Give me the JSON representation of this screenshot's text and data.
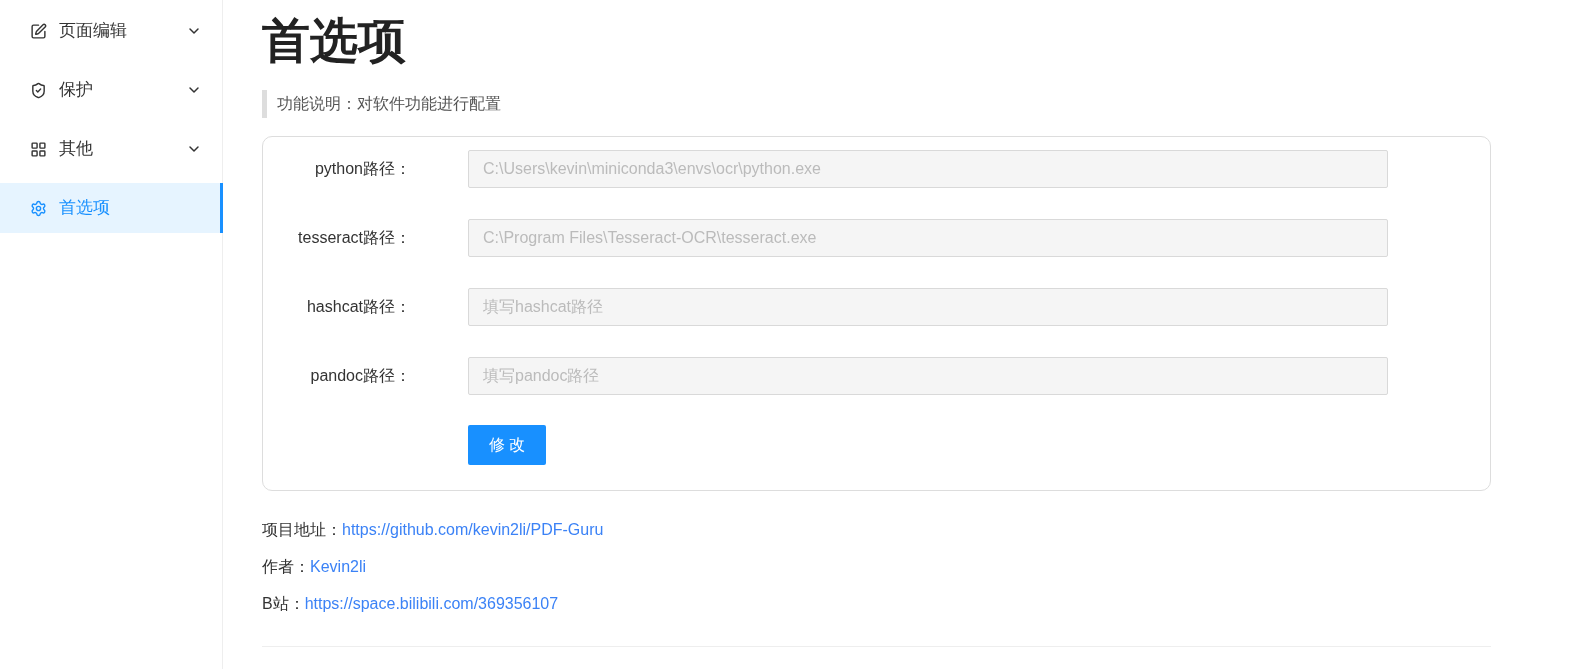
{
  "sidebar": {
    "items": [
      {
        "label": "页面编辑",
        "expandable": true,
        "selected": false
      },
      {
        "label": "保护",
        "expandable": true,
        "selected": false
      },
      {
        "label": "其他",
        "expandable": true,
        "selected": false
      },
      {
        "label": "首选项",
        "expandable": false,
        "selected": true
      }
    ]
  },
  "page": {
    "title": "首选项",
    "description": "功能说明：对软件功能进行配置"
  },
  "form": {
    "fields": [
      {
        "label": "python路径：",
        "value": "C:\\Users\\kevin\\miniconda3\\envs\\ocr\\python.exe",
        "disabled": true
      },
      {
        "label": "tesseract路径：",
        "value": "C:\\Program Files\\Tesseract-OCR\\tesseract.exe",
        "disabled": true
      },
      {
        "label": "hashcat路径：",
        "placeholder": "填写hashcat路径",
        "disabled": true
      },
      {
        "label": "pandoc路径：",
        "placeholder": "填写pandoc路径",
        "disabled": true
      }
    ],
    "submit": "修 改"
  },
  "info": [
    {
      "label": "项目地址：",
      "link": "https://github.com/kevin2li/PDF-Guru"
    },
    {
      "label": "作者：",
      "link": "Kevin2li"
    },
    {
      "label": "B站：",
      "link": "https://space.bilibili.com/369356107"
    }
  ]
}
